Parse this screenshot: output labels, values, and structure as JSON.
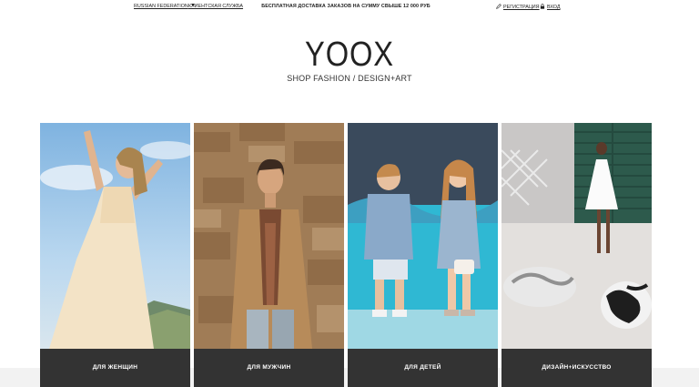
{
  "topbar": {
    "region": "RUSSIAN FEDERATION",
    "customer_service": "КЛИЕНТСКАЯ СЛУЖБА",
    "promo": "БЕСПЛАТНАЯ ДОСТАВКА ЗАКАЗОВ НА СУММУ СВЫШЕ 12 000 РУБ",
    "register": "РЕГИСТРАЦИЯ",
    "login": "ВХОД"
  },
  "brand": {
    "title": "YOOX",
    "subtitle": "SHOP FASHION / DESIGN+ART"
  },
  "categories": [
    {
      "label": "ДЛЯ ЖЕНЩИН"
    },
    {
      "label": "ДЛЯ МУЖЧИН"
    },
    {
      "label": "ДЛЯ ДЕТЕЙ"
    },
    {
      "label": "ДИЗАЙН+ИСКУССТВО"
    }
  ],
  "colors": {
    "label_bg": "#333333",
    "text": "#222222"
  }
}
